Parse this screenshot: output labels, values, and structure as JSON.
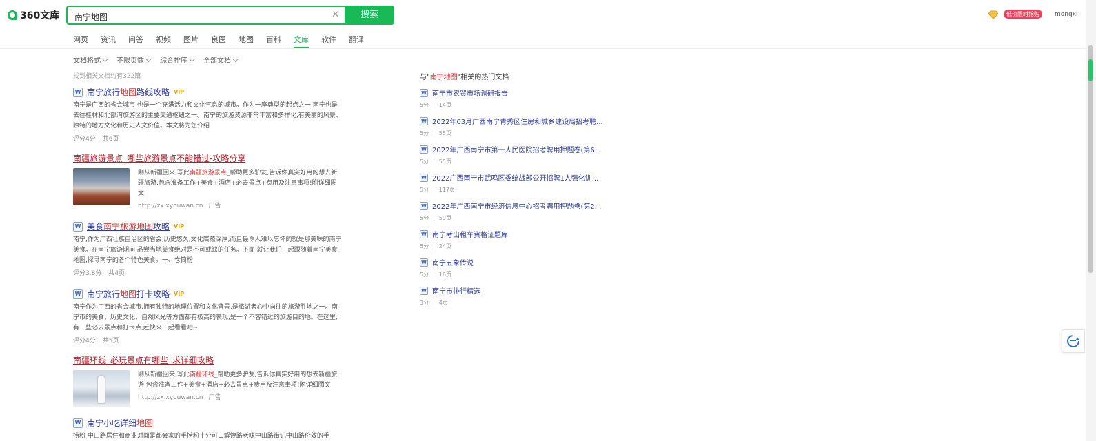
{
  "app": {
    "logo_text": "360文库"
  },
  "search": {
    "value": "南宁地图",
    "button_label": "搜索"
  },
  "nav": [
    "网页",
    "资讯",
    "问答",
    "视频",
    "图片",
    "良医",
    "地图",
    "百科",
    "文库",
    "软件",
    "翻译"
  ],
  "nav_active": "文库",
  "header_right": {
    "promo": "低价限时抢购",
    "username": "mongxi"
  },
  "filters": [
    "文档格式",
    "不限页数",
    "综合排序",
    "全部文档"
  ],
  "result_count": "找到相关文档约有322篇",
  "results": [
    {
      "type": "doc",
      "title_pre": "南宁旅行",
      "title_hl": "地图",
      "title_post": "路线攻略",
      "vip": "VIP",
      "desc": "南宁是广西的省会城市,也是一个充满活力和文化气息的城市。作为一座典型的起点之一,南宁也是去往桂林和北部湾旅游区的主要交通枢纽之一。南宁的旅游资源非常丰富和多样化,有美丽的风景、独特的地方文化和历史人文价值。本文将为您介绍",
      "score": "评分4分",
      "pages": "共6页"
    },
    {
      "type": "ad",
      "title": "南疆旅游景点_哪些旅游景点不能错过-攻略分享",
      "text_pre": "刚从新疆回来,写此",
      "text_hl": "南疆旅游景点",
      "text_post": "_帮助更多驴友,告诉你真实好用的想去新疆旅游,包含准备工作+美食+酒店+必去景点+费用及注意事项!附详细图文",
      "url": "http://zx.xyouwan.cn",
      "ad_label": "广告"
    },
    {
      "type": "doc",
      "title_pre": "美食",
      "title_hl": "南宁旅游地图",
      "title_post": "攻略",
      "vip": "VIP",
      "desc": "南宁,作为广西壮族自治区的省会,历史悠久,文化底蕴深厚,而且最令人难以忘怀的就是那美味的南宁美食。在南宁旅游期间,品尝当地美食绝对是不可或缺的任务。下面,就让我们一起跟随着南宁美食地图,探寻南宁的各个特色美食。一、卷筒粉",
      "score": "评分3.8分",
      "pages": "共4页"
    },
    {
      "type": "doc",
      "title_pre": "南宁旅行",
      "title_hl": "地图",
      "title_post": "打卡攻略",
      "vip": "VIP",
      "desc": "南宁作为广西的省会城市,拥有独特的地理位置和文化背景,是旅游者心中向往的旅游胜地之一。南宁市的美食、历史文化、自然风光等方面都有极高的表现,是一个不容错过的旅游目的地。在这里,有一些必去景点和打卡点,赶快来一起看看吧~",
      "score": "评分4分",
      "pages": "共5页"
    },
    {
      "type": "ad",
      "title": "南疆环线_必玩景点有哪些_求详细攻略",
      "text_pre": "刚从新疆回来,写此",
      "text_hl": "南疆环线",
      "text_post": "_帮助更多驴友,告诉你真实好用的想去新疆旅游,包含准备工作+美食+酒店+必去景点+费用及注意事项!附详细图文",
      "url": "http://zx.xyouwan.cn",
      "ad_label": "广告"
    },
    {
      "type": "doc",
      "title_pre": "南宁小吃详细",
      "title_hl": "地图",
      "title_post": "",
      "vip": "",
      "desc": "捞粉 中山路居住和商业对面是都会家的手捞粉十分可口解馋路老味中山路街记中山路价效的手"
    }
  ],
  "sidebar": {
    "title_pre": "与\"",
    "title_hl": "南宁地图",
    "title_post": "\"相关的热门文档",
    "items": [
      {
        "title": "南宁市农贸市场调研报告",
        "score": "5分",
        "pages": "14页"
      },
      {
        "title": "2022年03月广西南宁青秀区住房和城乡建设局招考聘...",
        "score": "5分",
        "pages": "55页"
      },
      {
        "title": "2022年广西南宁市第一人民医院招考聘用押题卷(第6...",
        "score": "5分",
        "pages": "55页"
      },
      {
        "title": "2022广西南宁市武鸣区委统战部公开招聘1人强化训...",
        "score": "5分",
        "pages": "117页"
      },
      {
        "title": "2022年广西南宁市经济信息中心招考聘用押题卷(第2...",
        "score": "5分",
        "pages": "59页"
      },
      {
        "title": "南宁考出租车资格证题库",
        "score": "5分",
        "pages": "24页"
      },
      {
        "title": "南宁五象传说",
        "score": "5分",
        "pages": "16页"
      },
      {
        "title": "南宁市排行精选",
        "score": "3分",
        "pages": "4页"
      }
    ]
  },
  "colors": {
    "accent": "#19b955",
    "link": "#2a3a9a",
    "highlight": "#d53838",
    "ad_title": "#b21e26",
    "promo": "#e8435a"
  }
}
